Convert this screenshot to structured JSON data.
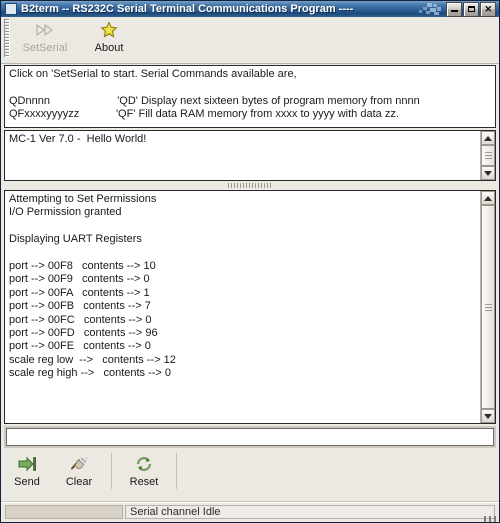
{
  "window": {
    "title": "B2term -- RS232C Serial Terminal Communications Program ----",
    "icon": "window-icon",
    "buttons": {
      "minimize": "–",
      "maximize": "□",
      "close": "✕"
    }
  },
  "toolbar": {
    "items": [
      {
        "label": "SetSerial",
        "icon": "double-arrow-icon",
        "disabled": true
      },
      {
        "label": "About",
        "icon": "star-icon",
        "disabled": false
      }
    ]
  },
  "help_panel": {
    "text": "Click on 'SetSerial to start. Serial Commands available are,\n\nQDnnnn                      'QD' Display next sixteen bytes of program memory from nnnn\nQFxxxxyyyyzz            'QF' Fill data RAM memory from xxxx to yyyy with data zz."
  },
  "receive_panel": {
    "text": "MC-1 Ver 7.0 -  Hello World!"
  },
  "log_panel": {
    "text": "Attempting to Set Permissions\nI/O Permission granted\n\nDisplaying UART Registers\n\nport --> 00F8   contents --> 10\nport --> 00F9   contents --> 0\nport --> 00FA   contents --> 1\nport --> 00FB   contents --> 7\nport --> 00FC   contents --> 0\nport --> 00FD   contents --> 96\nport --> 00FE   contents --> 0\nscale reg low  -->   contents --> 12\nscale reg high -->   contents --> 0"
  },
  "command_input": {
    "value": "",
    "placeholder": ""
  },
  "action_bar": {
    "items": [
      {
        "label": "Send",
        "icon": "arrow-to-bar-icon"
      },
      {
        "label": "Clear",
        "icon": "broom-icon"
      },
      {
        "label": "Reset",
        "icon": "refresh-icon"
      }
    ]
  },
  "statusbar": {
    "left": "",
    "message": "Serial channel Idle"
  },
  "colors": {
    "titlebar": "#2d5f96",
    "window_bg": "#ece9e3",
    "panel_bg": "#ffffff",
    "star": "#e8d423",
    "icon_green": "#6d9c5c"
  }
}
